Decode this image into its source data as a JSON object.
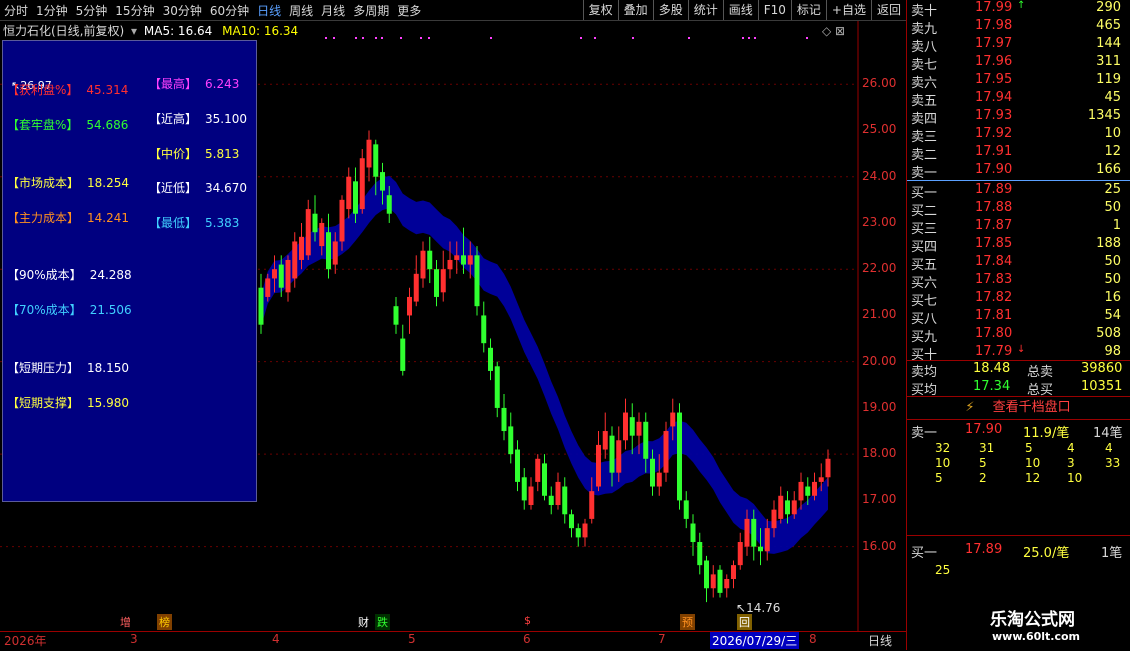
{
  "toolbar": {
    "periods": [
      "分时",
      "1分钟",
      "5分钟",
      "15分钟",
      "30分钟",
      "60分钟",
      "日线",
      "周线",
      "月线",
      "多周期",
      "更多"
    ],
    "active_period": "日线",
    "buttons": [
      "复权",
      "叠加",
      "多股",
      "统计",
      "画线",
      "F10",
      "标记",
      "+自选",
      "返回"
    ]
  },
  "title": {
    "name": "恒力石化(日线,前复权)",
    "ma5": "MA5: 16.64",
    "ma10": "MA10: 16.34"
  },
  "high_label": "26.97",
  "low_label": "14.76",
  "panel": {
    "left_items": [
      {
        "label": "【获利盘%】",
        "value": "45.314",
        "color": "#ff3030"
      },
      {
        "label": "【套牢盘%】",
        "value": "54.686",
        "color": "#30ff30"
      },
      {
        "label": "【市场成本】",
        "value": "18.254",
        "color": "#ffff40"
      },
      {
        "label": "【主力成本】",
        "value": "14.241",
        "color": "#ff9020"
      },
      {
        "label": "【90%成本】",
        "value": "24.288",
        "color": "#ffffff"
      },
      {
        "label": "【70%成本】",
        "value": "21.506",
        "color": "#40d0ff"
      },
      {
        "label": "【短期压力】",
        "value": "18.150",
        "color": "#ffffff"
      },
      {
        "label": "【短期支撑】",
        "value": "15.980",
        "color": "#ffff40"
      }
    ],
    "right_items": [
      {
        "label": "【最高】",
        "value": "6.243",
        "color": "#ff40ff"
      },
      {
        "label": "【近高】",
        "value": "35.100",
        "color": "#ffffff"
      },
      {
        "label": "【中价】",
        "value": "5.813",
        "color": "#ffff40"
      },
      {
        "label": "【近低】",
        "value": "34.670",
        "color": "#ffffff"
      },
      {
        "label": "【最低】",
        "value": "5.383",
        "color": "#40d0ff"
      }
    ]
  },
  "y_axis": [
    "26.00",
    "25.00",
    "24.00",
    "23.00",
    "22.00",
    "21.00",
    "20.00",
    "19.00",
    "18.00",
    "17.00",
    "16.00"
  ],
  "x_axis": [
    "2026年",
    "3",
    "4",
    "5",
    "6",
    "7",
    "2026/07/29/三",
    "8",
    "日线"
  ],
  "events": [
    "增",
    "榜",
    "财",
    "跌",
    "$",
    "预",
    "回"
  ],
  "chart_data": {
    "type": "candlestick",
    "ylim": [
      14.5,
      27.0
    ],
    "candles": [
      {
        "o": 21.6,
        "c": 20.8,
        "h": 21.9,
        "l": 20.6
      },
      {
        "o": 21.4,
        "c": 21.8,
        "h": 21.9,
        "l": 21.3
      },
      {
        "o": 21.8,
        "c": 22.0,
        "h": 22.3,
        "l": 21.5
      },
      {
        "o": 22.1,
        "c": 21.6,
        "h": 22.3,
        "l": 21.4
      },
      {
        "o": 21.5,
        "c": 22.2,
        "h": 22.3,
        "l": 21.3
      },
      {
        "o": 21.8,
        "c": 22.6,
        "h": 22.8,
        "l": 21.6
      },
      {
        "o": 22.2,
        "c": 22.7,
        "h": 23.0,
        "l": 22.0
      },
      {
        "o": 22.3,
        "c": 23.3,
        "h": 23.5,
        "l": 22.2
      },
      {
        "o": 23.2,
        "c": 22.8,
        "h": 23.6,
        "l": 22.6
      },
      {
        "o": 22.5,
        "c": 23.0,
        "h": 23.1,
        "l": 22.3
      },
      {
        "o": 22.8,
        "c": 22.0,
        "h": 23.2,
        "l": 21.8
      },
      {
        "o": 22.1,
        "c": 22.6,
        "h": 22.8,
        "l": 21.9
      },
      {
        "o": 22.6,
        "c": 23.5,
        "h": 23.6,
        "l": 22.4
      },
      {
        "o": 23.3,
        "c": 24.0,
        "h": 24.2,
        "l": 23.1
      },
      {
        "o": 23.9,
        "c": 23.2,
        "h": 24.2,
        "l": 23.0
      },
      {
        "o": 23.3,
        "c": 24.4,
        "h": 24.6,
        "l": 23.2
      },
      {
        "o": 24.2,
        "c": 24.8,
        "h": 25.0,
        "l": 23.9
      },
      {
        "o": 24.7,
        "c": 24.0,
        "h": 24.8,
        "l": 23.6
      },
      {
        "o": 24.1,
        "c": 23.7,
        "h": 24.3,
        "l": 23.4
      },
      {
        "o": 23.6,
        "c": 23.2,
        "h": 23.8,
        "l": 23.0
      },
      {
        "o": 21.2,
        "c": 20.8,
        "h": 21.4,
        "l": 20.6
      },
      {
        "o": 20.5,
        "c": 19.8,
        "h": 20.8,
        "l": 19.7
      },
      {
        "o": 21.0,
        "c": 21.4,
        "h": 21.6,
        "l": 20.6
      },
      {
        "o": 21.3,
        "c": 21.9,
        "h": 22.3,
        "l": 21.2
      },
      {
        "o": 21.8,
        "c": 22.4,
        "h": 22.6,
        "l": 21.6
      },
      {
        "o": 22.4,
        "c": 22.0,
        "h": 22.7,
        "l": 21.7
      },
      {
        "o": 22.0,
        "c": 21.4,
        "h": 22.2,
        "l": 21.2
      },
      {
        "o": 21.5,
        "c": 22.0,
        "h": 22.4,
        "l": 21.3
      },
      {
        "o": 22.0,
        "c": 22.2,
        "h": 22.6,
        "l": 21.8
      },
      {
        "o": 22.2,
        "c": 22.3,
        "h": 22.6,
        "l": 21.9
      },
      {
        "o": 22.3,
        "c": 22.1,
        "h": 22.9,
        "l": 21.9
      },
      {
        "o": 22.1,
        "c": 22.3,
        "h": 22.6,
        "l": 21.8
      },
      {
        "o": 22.3,
        "c": 21.2,
        "h": 22.5,
        "l": 21.0
      },
      {
        "o": 21.0,
        "c": 20.4,
        "h": 21.3,
        "l": 20.2
      },
      {
        "o": 20.3,
        "c": 19.8,
        "h": 20.5,
        "l": 19.6
      },
      {
        "o": 19.9,
        "c": 19.0,
        "h": 20.0,
        "l": 18.8
      },
      {
        "o": 19.0,
        "c": 18.5,
        "h": 19.3,
        "l": 18.3
      },
      {
        "o": 18.6,
        "c": 18.0,
        "h": 18.9,
        "l": 17.8
      },
      {
        "o": 18.1,
        "c": 17.4,
        "h": 18.3,
        "l": 17.2
      },
      {
        "o": 17.5,
        "c": 17.0,
        "h": 17.7,
        "l": 16.8
      },
      {
        "o": 16.9,
        "c": 17.3,
        "h": 17.5,
        "l": 16.8
      },
      {
        "o": 17.4,
        "c": 17.9,
        "h": 18.0,
        "l": 17.2
      },
      {
        "o": 17.8,
        "c": 17.1,
        "h": 18.0,
        "l": 17.0
      },
      {
        "o": 17.1,
        "c": 16.9,
        "h": 17.3,
        "l": 16.7
      },
      {
        "o": 16.9,
        "c": 17.4,
        "h": 17.6,
        "l": 16.8
      },
      {
        "o": 17.3,
        "c": 16.7,
        "h": 17.5,
        "l": 16.5
      },
      {
        "o": 16.7,
        "c": 16.4,
        "h": 16.8,
        "l": 16.2
      },
      {
        "o": 16.4,
        "c": 16.2,
        "h": 16.5,
        "l": 16.0
      },
      {
        "o": 16.2,
        "c": 16.5,
        "h": 16.6,
        "l": 16.0
      },
      {
        "o": 16.6,
        "c": 17.2,
        "h": 17.5,
        "l": 16.5
      },
      {
        "o": 17.3,
        "c": 18.2,
        "h": 18.5,
        "l": 17.2
      },
      {
        "o": 18.1,
        "c": 18.5,
        "h": 18.9,
        "l": 17.9
      },
      {
        "o": 18.4,
        "c": 17.6,
        "h": 18.6,
        "l": 17.3
      },
      {
        "o": 17.6,
        "c": 18.3,
        "h": 18.6,
        "l": 17.4
      },
      {
        "o": 18.3,
        "c": 18.9,
        "h": 19.2,
        "l": 18.1
      },
      {
        "o": 18.8,
        "c": 18.4,
        "h": 19.1,
        "l": 18.0
      },
      {
        "o": 18.4,
        "c": 18.7,
        "h": 18.9,
        "l": 18.0
      },
      {
        "o": 18.7,
        "c": 17.9,
        "h": 18.9,
        "l": 17.6
      },
      {
        "o": 17.9,
        "c": 17.3,
        "h": 18.1,
        "l": 17.1
      },
      {
        "o": 17.3,
        "c": 17.6,
        "h": 18.0,
        "l": 17.1
      },
      {
        "o": 17.6,
        "c": 18.5,
        "h": 18.7,
        "l": 17.4
      },
      {
        "o": 18.6,
        "c": 18.9,
        "h": 19.2,
        "l": 18.3
      },
      {
        "o": 18.9,
        "c": 17.0,
        "h": 19.1,
        "l": 16.8
      },
      {
        "o": 17.0,
        "c": 16.6,
        "h": 17.2,
        "l": 16.4
      },
      {
        "o": 16.5,
        "c": 16.1,
        "h": 16.7,
        "l": 15.8
      },
      {
        "o": 16.1,
        "c": 15.6,
        "h": 16.3,
        "l": 15.4
      },
      {
        "o": 15.7,
        "c": 15.1,
        "h": 15.8,
        "l": 14.8
      },
      {
        "o": 15.1,
        "c": 15.4,
        "h": 15.6,
        "l": 14.9
      },
      {
        "o": 15.5,
        "c": 15.0,
        "h": 15.6,
        "l": 14.9
      },
      {
        "o": 15.1,
        "c": 15.3,
        "h": 15.4,
        "l": 14.9
      },
      {
        "o": 15.3,
        "c": 15.6,
        "h": 15.7,
        "l": 15.1
      },
      {
        "o": 15.6,
        "c": 16.1,
        "h": 16.3,
        "l": 15.5
      },
      {
        "o": 16.0,
        "c": 16.6,
        "h": 16.8,
        "l": 15.8
      },
      {
        "o": 16.6,
        "c": 16.0,
        "h": 16.8,
        "l": 15.7
      },
      {
        "o": 16.0,
        "c": 15.9,
        "h": 16.4,
        "l": 15.6
      },
      {
        "o": 15.9,
        "c": 16.4,
        "h": 16.6,
        "l": 15.7
      },
      {
        "o": 16.4,
        "c": 16.8,
        "h": 17.0,
        "l": 16.2
      },
      {
        "o": 16.6,
        "c": 17.1,
        "h": 17.3,
        "l": 16.5
      },
      {
        "o": 17.0,
        "c": 16.7,
        "h": 17.2,
        "l": 16.5
      },
      {
        "o": 16.7,
        "c": 17.0,
        "h": 17.2,
        "l": 16.6
      },
      {
        "o": 17.0,
        "c": 17.4,
        "h": 17.6,
        "l": 16.8
      },
      {
        "o": 17.3,
        "c": 17.1,
        "h": 17.5,
        "l": 16.9
      },
      {
        "o": 17.1,
        "c": 17.4,
        "h": 17.6,
        "l": 17.0
      },
      {
        "o": 17.4,
        "c": 17.5,
        "h": 17.8,
        "l": 17.2
      },
      {
        "o": 17.5,
        "c": 17.9,
        "h": 18.1,
        "l": 17.3
      }
    ]
  },
  "orderbook": [
    {
      "label": "卖十",
      "price": "17.99",
      "vol": "290",
      "arrow": "↑"
    },
    {
      "label": "卖九",
      "price": "17.98",
      "vol": "465"
    },
    {
      "label": "卖八",
      "price": "17.97",
      "vol": "144"
    },
    {
      "label": "卖七",
      "price": "17.96",
      "vol": "311"
    },
    {
      "label": "卖六",
      "price": "17.95",
      "vol": "119"
    },
    {
      "label": "卖五",
      "price": "17.94",
      "vol": "45"
    },
    {
      "label": "卖四",
      "price": "17.93",
      "vol": "1345"
    },
    {
      "label": "卖三",
      "price": "17.92",
      "vol": "10"
    },
    {
      "label": "卖二",
      "price": "17.91",
      "vol": "12"
    },
    {
      "label": "卖一",
      "price": "17.90",
      "vol": "166"
    },
    {
      "label": "买一",
      "price": "17.89",
      "vol": "25"
    },
    {
      "label": "买二",
      "price": "17.88",
      "vol": "50"
    },
    {
      "label": "买三",
      "price": "17.87",
      "vol": "1"
    },
    {
      "label": "买四",
      "price": "17.85",
      "vol": "188"
    },
    {
      "label": "买五",
      "price": "17.84",
      "vol": "50"
    },
    {
      "label": "买六",
      "price": "17.83",
      "vol": "50"
    },
    {
      "label": "买七",
      "price": "17.82",
      "vol": "16"
    },
    {
      "label": "买八",
      "price": "17.81",
      "vol": "54"
    },
    {
      "label": "买九",
      "price": "17.80",
      "vol": "508"
    },
    {
      "label": "买十",
      "price": "17.79",
      "vol": "98",
      "arrow": "↓"
    }
  ],
  "summary": {
    "sell_avg_label": "卖均",
    "sell_avg": "18.48",
    "total_sell_label": "总卖",
    "total_sell": "39860",
    "buy_avg_label": "买均",
    "buy_avg": "17.34",
    "total_buy_label": "总买",
    "total_buy": "10351"
  },
  "qian_dang_link": "查看千档盘口",
  "sell1_detail": {
    "label": "卖一",
    "price": "17.90",
    "per": "11.9/笔",
    "count": "14笔",
    "rows": [
      [
        "32",
        "31",
        "5",
        "4",
        "4"
      ],
      [
        "10",
        "5",
        "10",
        "3",
        "33"
      ],
      [
        "5",
        "2",
        "12",
        "10",
        ""
      ]
    ]
  },
  "buy1_detail": {
    "label": "买一",
    "price": "17.89",
    "per": "25.0/笔",
    "count": "1笔",
    "rows": [
      [
        "25"
      ]
    ]
  },
  "watermark": {
    "line1": "乐淘公式网",
    "line2": "www.60lt.com"
  },
  "colors": {
    "up": "#ff3030",
    "down": "#30ff30",
    "blue_band": "#0000a0",
    "gold_band": "#8a8a10",
    "grid": "#9a0000",
    "panel_bg": "#000080"
  }
}
